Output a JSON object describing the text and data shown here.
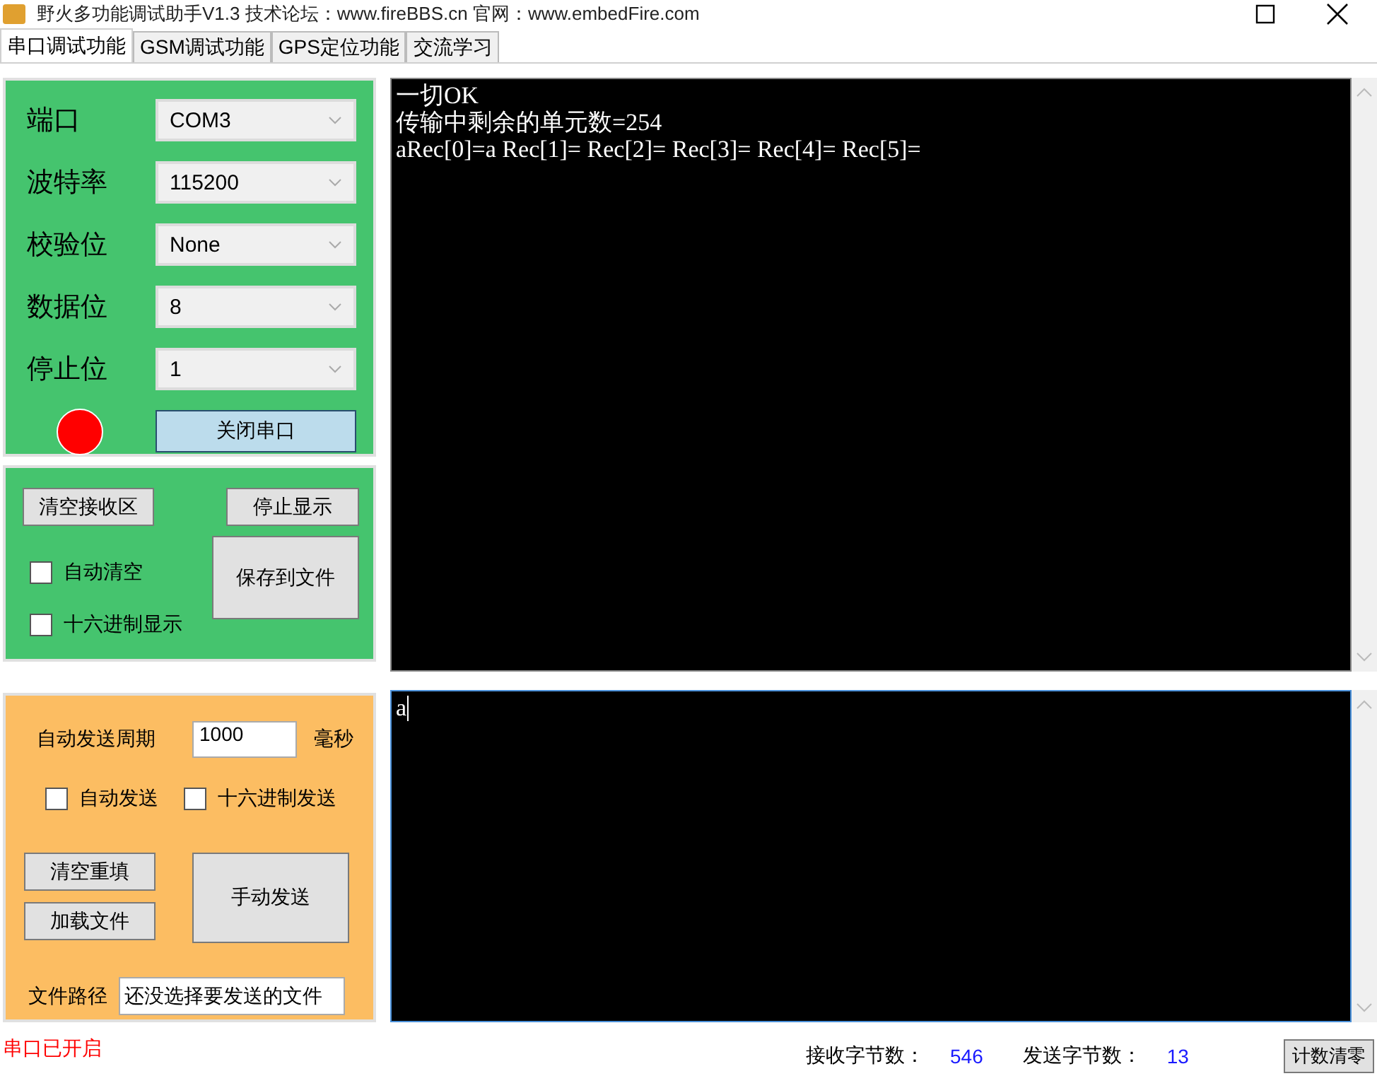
{
  "window": {
    "title": "野火多功能调试助手V1.3    技术论坛：www.fireBBS.cn    官网：www.embedFire.com"
  },
  "tabs": [
    {
      "label": "串口调试功能",
      "selected": true
    },
    {
      "label": "GSM调试功能",
      "selected": false
    },
    {
      "label": "GPS定位功能",
      "selected": false
    },
    {
      "label": "交流学习",
      "selected": false
    }
  ],
  "port_settings": {
    "fields": [
      {
        "label": "端口",
        "value": "COM3"
      },
      {
        "label": "波特率",
        "value": "115200"
      },
      {
        "label": "校验位",
        "value": "None"
      },
      {
        "label": "数据位",
        "value": "8"
      },
      {
        "label": "停止位",
        "value": "1"
      }
    ],
    "indicator_on": true,
    "toggle_button": "关闭串口"
  },
  "receive_controls": {
    "buttons": [
      "清空接收区",
      "停止显示"
    ],
    "checkboxes": [
      {
        "label": "自动清空",
        "checked": false
      },
      {
        "label": "十六进制显示",
        "checked": false
      }
    ],
    "save_button": "保存到文件"
  },
  "send_controls": {
    "period_label": "自动发送周期",
    "period_value": "1000",
    "period_unit": "毫秒",
    "checkboxes": [
      {
        "label": "自动发送",
        "checked": false
      },
      {
        "label": "十六进制发送",
        "checked": false
      }
    ],
    "clear_button": "清空重填",
    "load_button": "加载文件",
    "send_button": "手动发送",
    "path_label": "文件路径",
    "path_value": "还没选择要发送的文件"
  },
  "receive_area": {
    "lines": [
      "一切OK",
      "传输中剩余的单元数=254",
      "aRec[0]=a Rec[1]= Rec[2]= Rec[3]= Rec[4]= Rec[5]="
    ]
  },
  "send_area": {
    "value": "a"
  },
  "status_bar": {
    "port_status": "串口已开启",
    "rx_label": "接收字节数：",
    "rx_count": "546",
    "tx_label": "发送字节数：",
    "tx_count": "13",
    "reset_button": "计数清零"
  }
}
